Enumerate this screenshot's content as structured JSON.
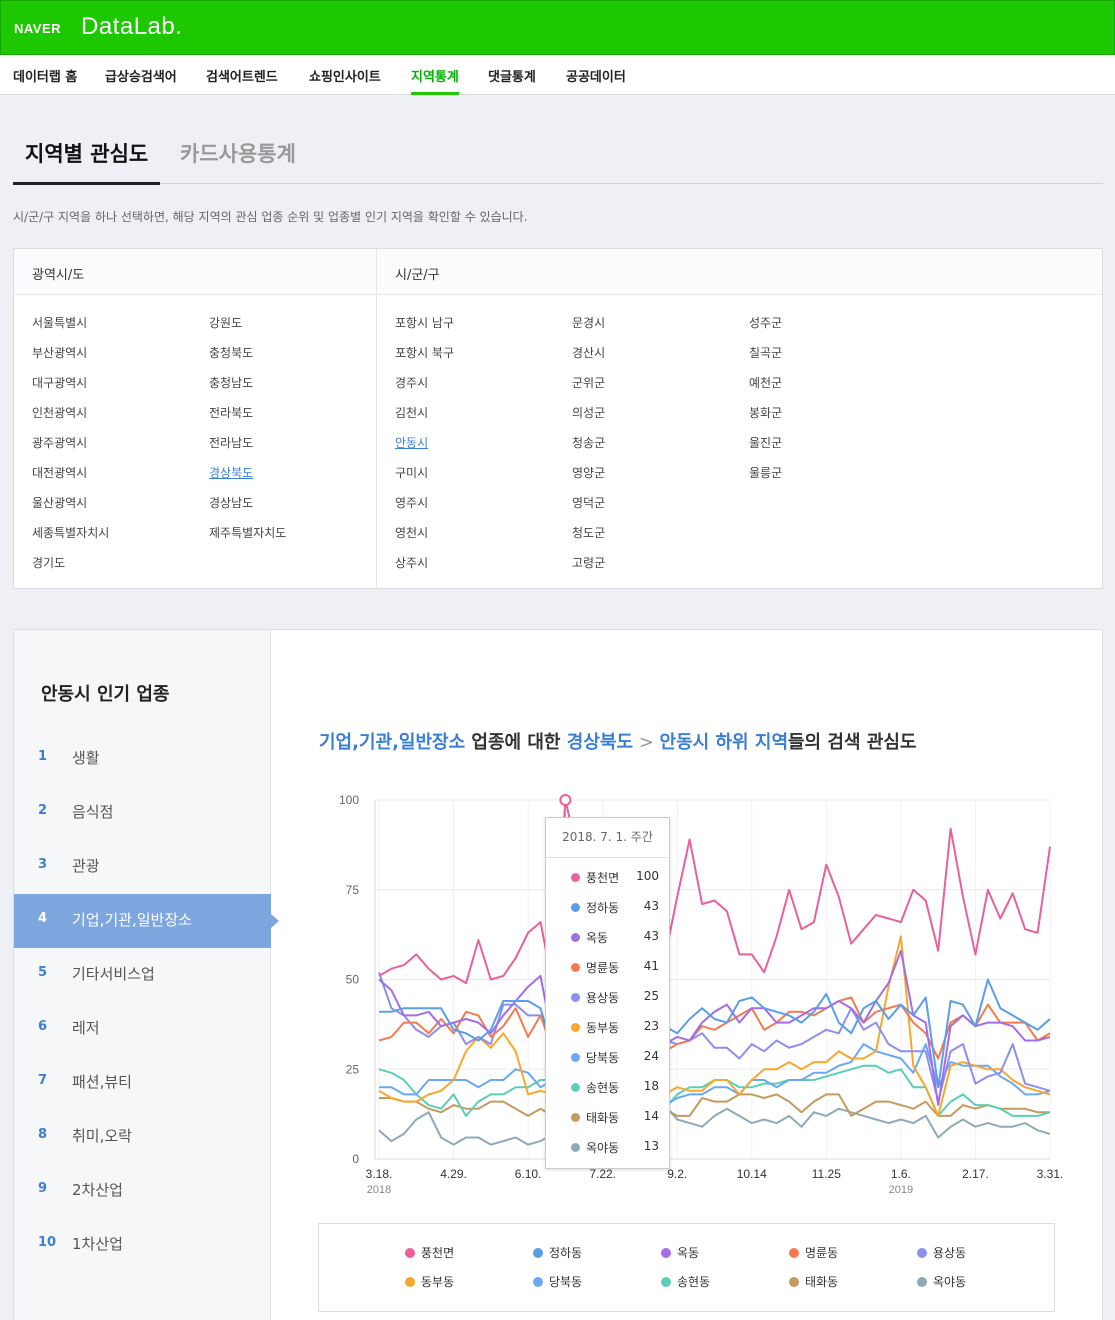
{
  "header": {
    "logo_naver": "NAVER",
    "logo_datalab": "DataLab."
  },
  "gnb": [
    {
      "label": "데이터랩 홈",
      "active": false
    },
    {
      "label": "급상승검색어",
      "active": false
    },
    {
      "label": "검색어트렌드",
      "active": false
    },
    {
      "label": "쇼핑인사이트",
      "active": false
    },
    {
      "label": "지역통계",
      "active": true
    },
    {
      "label": "댓글통계",
      "active": false
    },
    {
      "label": "공공데이터",
      "active": false
    }
  ],
  "tabs": {
    "active": "지역별 관심도",
    "inactive": "카드사용통계"
  },
  "description": "시/군/구 지역을 하나 선택하면, 해당 지역의 관심 업종 순위 및 업종별 인기 지역을 확인할 수 있습니다.",
  "region": {
    "province_header": "광역시/도",
    "city_header": "시/군/구",
    "provinces_col1": [
      "서울특별시",
      "부산광역시",
      "대구광역시",
      "인천광역시",
      "광주광역시",
      "대전광역시",
      "울산광역시",
      "세종특별자치시",
      "경기도"
    ],
    "provinces_col2": [
      "강원도",
      "충청북도",
      "충청남도",
      "전라북도",
      "전라남도",
      "경상북도",
      "경상남도",
      "제주특별자치도"
    ],
    "selected_province": "경상북도",
    "cities_col1": [
      "포항시 남구",
      "포항시 북구",
      "경주시",
      "김천시",
      "안동시",
      "구미시",
      "영주시",
      "영천시",
      "상주시"
    ],
    "cities_col2": [
      "문경시",
      "경산시",
      "군위군",
      "의성군",
      "청송군",
      "영양군",
      "영덕군",
      "청도군",
      "고령군"
    ],
    "cities_col3": [
      "성주군",
      "칠곡군",
      "예천군",
      "봉화군",
      "울진군",
      "울릉군"
    ],
    "selected_city": "안동시"
  },
  "sidebar": {
    "title": "안동시 인기 업종",
    "items": [
      {
        "num": "1",
        "label": "생활"
      },
      {
        "num": "2",
        "label": "음식점"
      },
      {
        "num": "3",
        "label": "관광"
      },
      {
        "num": "4",
        "label": "기업,기관,일반장소",
        "active": true
      },
      {
        "num": "5",
        "label": "기타서비스업"
      },
      {
        "num": "6",
        "label": "레저"
      },
      {
        "num": "7",
        "label": "패션,뷰티"
      },
      {
        "num": "8",
        "label": "취미,오락"
      },
      {
        "num": "9",
        "label": "2차산업"
      },
      {
        "num": "10",
        "label": "1차산업"
      }
    ]
  },
  "chart_title": {
    "part1": "기업,기관,일반장소",
    "part2": " 업종에 대한 ",
    "part3": "경상북도",
    "part4": " > ",
    "part5": "안동시 하위 지역",
    "part6": "들의 검색 관심도"
  },
  "tooltip": {
    "title": "2018. 7. 1. 주간",
    "rows": [
      {
        "name": "풍천면",
        "value": "100",
        "color": "#e8609c"
      },
      {
        "name": "정하동",
        "value": "43",
        "color": "#5a9ee8"
      },
      {
        "name": "옥동",
        "value": "43",
        "color": "#a26ee8"
      },
      {
        "name": "명륜동",
        "value": "41",
        "color": "#f47a4f"
      },
      {
        "name": "용상동",
        "value": "25",
        "color": "#8c8ef0"
      },
      {
        "name": "동부동",
        "value": "23",
        "color": "#f7a72b"
      },
      {
        "name": "당북동",
        "value": "24",
        "color": "#6aa8f7"
      },
      {
        "name": "송현동",
        "value": "18",
        "color": "#5ccdb6"
      },
      {
        "name": "태화동",
        "value": "14",
        "color": "#c49a5e"
      },
      {
        "name": "옥야동",
        "value": "13",
        "color": "#8ea9b8"
      }
    ]
  },
  "chart_data": {
    "type": "line",
    "x_tick_labels": [
      "3.18.",
      "4.29.",
      "6.10.",
      "7.22.",
      "9.2.",
      "10.14",
      "11.25",
      "1.6.",
      "2.17.",
      "3.31."
    ],
    "x_year_labels": [
      {
        "label": "2018",
        "at": "3.18."
      },
      {
        "label": "2019",
        "at": "1.6."
      }
    ],
    "ylim": [
      0,
      100
    ],
    "y_ticks": [
      0,
      25,
      50,
      75,
      100
    ],
    "highlight_week": "2018. 7. 1.",
    "series": [
      {
        "name": "풍천면",
        "color": "#e8609c",
        "values": [
          51,
          53,
          54,
          57,
          53,
          50,
          51,
          49,
          61,
          50,
          51,
          56,
          63,
          66,
          48,
          100,
          85,
          52,
          46,
          44,
          44,
          63,
          25,
          56,
          73,
          89,
          71,
          72,
          69,
          57,
          57,
          52,
          62,
          75,
          64,
          66,
          82,
          73,
          60,
          64,
          68,
          67,
          66,
          75,
          72,
          58,
          92,
          73,
          57,
          75,
          67,
          74,
          64,
          63,
          87
        ]
      },
      {
        "name": "정하동",
        "color": "#5a9ee8",
        "values": [
          41,
          41,
          42,
          42,
          42,
          42,
          36,
          35,
          33,
          36,
          44,
          44,
          44,
          42,
          30,
          43,
          40,
          42,
          41,
          40,
          40,
          43,
          22,
          37,
          35,
          39,
          42,
          39,
          38,
          44,
          45,
          42,
          41,
          40,
          38,
          41,
          46,
          38,
          35,
          42,
          44,
          39,
          43,
          40,
          45,
          20,
          44,
          43,
          37,
          50,
          42,
          40,
          38,
          36,
          39
        ]
      },
      {
        "name": "옥동",
        "color": "#a26ee8",
        "values": [
          50,
          47,
          40,
          40,
          41,
          37,
          38,
          39,
          38,
          35,
          40,
          44,
          48,
          51,
          33,
          43,
          40,
          34,
          39,
          44,
          43,
          45,
          23,
          32,
          34,
          33,
          38,
          41,
          43,
          38,
          42,
          42,
          38,
          38,
          40,
          42,
          42,
          44,
          42,
          38,
          44,
          49,
          58,
          40,
          38,
          15,
          37,
          40,
          37,
          38,
          38,
          37,
          33,
          33,
          34
        ]
      },
      {
        "name": "명륜동",
        "color": "#f47a4f",
        "values": [
          33,
          34,
          38,
          38,
          35,
          39,
          35,
          41,
          40,
          34,
          37,
          42,
          34,
          40,
          30,
          41,
          46,
          39,
          38,
          38,
          37,
          36,
          24,
          30,
          32,
          33,
          37,
          36,
          38,
          40,
          42,
          36,
          38,
          41,
          41,
          40,
          42,
          44,
          45,
          38,
          41,
          42,
          43,
          38,
          35,
          28,
          38,
          40,
          37,
          43,
          38,
          38,
          38,
          33,
          35
        ]
      },
      {
        "name": "용상동",
        "color": "#8c8ef0",
        "values": [
          52,
          42,
          40,
          36,
          34,
          37,
          38,
          32,
          34,
          32,
          43,
          43,
          40,
          40,
          33,
          25,
          36,
          37,
          36,
          38,
          41,
          46,
          22,
          33,
          32,
          33,
          35,
          31,
          31,
          28,
          32,
          30,
          33,
          31,
          32,
          34,
          36,
          35,
          42,
          36,
          38,
          32,
          30,
          30,
          30,
          16,
          30,
          32,
          21,
          23,
          24,
          32,
          21,
          20,
          19
        ]
      },
      {
        "name": "동부동",
        "color": "#f7a72b",
        "values": [
          19,
          17,
          16,
          16,
          18,
          19,
          22,
          30,
          34,
          31,
          35,
          30,
          18,
          19,
          18,
          23,
          21,
          18,
          18,
          16,
          20,
          20,
          20,
          18,
          20,
          19,
          19,
          22,
          22,
          18,
          22,
          25,
          25,
          27,
          25,
          27,
          27,
          30,
          28,
          28,
          30,
          48,
          62,
          26,
          20,
          12,
          26,
          27,
          26,
          25,
          25,
          22,
          20,
          19,
          18
        ]
      },
      {
        "name": "당북동",
        "color": "#6aa8f7",
        "values": [
          20,
          20,
          18,
          18,
          22,
          22,
          22,
          22,
          20,
          22,
          22,
          25,
          24,
          20,
          22,
          24,
          20,
          23,
          22,
          20,
          20,
          21,
          18,
          15,
          17,
          18,
          18,
          20,
          20,
          18,
          22,
          22,
          20,
          22,
          22,
          24,
          24,
          26,
          27,
          32,
          30,
          29,
          28,
          24,
          32,
          20,
          27,
          26,
          26,
          26,
          23,
          21,
          18,
          18,
          19
        ]
      },
      {
        "name": "송현동",
        "color": "#5ccdb6",
        "values": [
          25,
          24,
          22,
          18,
          15,
          14,
          18,
          12,
          16,
          18,
          18,
          20,
          20,
          22,
          22,
          18,
          20,
          22,
          18,
          14,
          14,
          16,
          15,
          14,
          18,
          20,
          20,
          22,
          22,
          20,
          20,
          21,
          21,
          22,
          22,
          22,
          23,
          24,
          25,
          26,
          26,
          24,
          25,
          20,
          20,
          12,
          16,
          18,
          15,
          15,
          14,
          12,
          12,
          12,
          13
        ]
      },
      {
        "name": "태화동",
        "color": "#c49a5e",
        "values": [
          17,
          17,
          16,
          16,
          14,
          13,
          15,
          14,
          14,
          16,
          16,
          14,
          12,
          14,
          12,
          14,
          12,
          13,
          12,
          13,
          14,
          13,
          8,
          14,
          12,
          12,
          17,
          16,
          16,
          18,
          18,
          17,
          18,
          16,
          13,
          16,
          18,
          18,
          12,
          14,
          16,
          16,
          15,
          14,
          16,
          12,
          12,
          15,
          14,
          15,
          14,
          14,
          14,
          13,
          13
        ]
      },
      {
        "name": "옥야동",
        "color": "#8ea9b8",
        "values": [
          8,
          5,
          7,
          11,
          13,
          6,
          4,
          6,
          6,
          4,
          5,
          6,
          4,
          5,
          7,
          13,
          14,
          10,
          8,
          8,
          7,
          7,
          13,
          15,
          11,
          10,
          9,
          12,
          14,
          12,
          10,
          11,
          10,
          12,
          9,
          13,
          12,
          14,
          13,
          12,
          11,
          10,
          11,
          10,
          12,
          6,
          9,
          11,
          9,
          10,
          9,
          9,
          10,
          8,
          7
        ]
      }
    ]
  }
}
